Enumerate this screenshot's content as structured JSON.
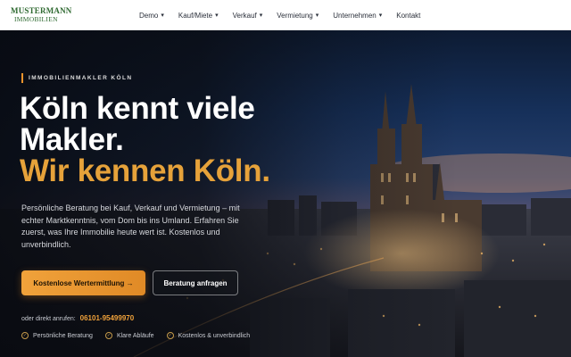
{
  "brand": {
    "line1": "Mustermann",
    "line2": "Immobilien"
  },
  "nav": {
    "items": [
      {
        "label": "Demo",
        "dropdown": true
      },
      {
        "label": "Kauf/Miete",
        "dropdown": true
      },
      {
        "label": "Verkauf",
        "dropdown": true
      },
      {
        "label": "Vermietung",
        "dropdown": true
      },
      {
        "label": "Unternehmen",
        "dropdown": true
      },
      {
        "label": "Kontakt",
        "dropdown": false
      }
    ],
    "chevron": "⌄"
  },
  "hero": {
    "eyebrow": "IMMOBILIENMAKLER KÖLN",
    "headline_1": "Köln kennt viele",
    "headline_2": "Makler.",
    "headline_3": "Wir kennen Köln.",
    "lead": "Persönliche Beratung bei Kauf, Verkauf und Vermietung – mit echter Marktkenntnis, vom Dom bis ins Umland. Erfahren Sie zuerst, was Ihre Immobilie heute wert ist. Kostenlos und unverbindlich.",
    "primary_button": "Kostenlose Wertermittlung →",
    "secondary_button": "Beratung anfragen",
    "call_label": "oder direkt anrufen:",
    "phone": "06101-95499970",
    "features": [
      {
        "label": "Persönliche Beratung",
        "icon": "check-circle-icon"
      },
      {
        "label": "Klare Abläufe",
        "icon": "check-circle-icon"
      },
      {
        "label": "Kostenlos & unverbindlich",
        "icon": "check-circle-icon"
      }
    ]
  },
  "colors": {
    "accent": "#e6a23a",
    "brand_green": "#2f6a31",
    "nav_bg": "#ffffff"
  }
}
